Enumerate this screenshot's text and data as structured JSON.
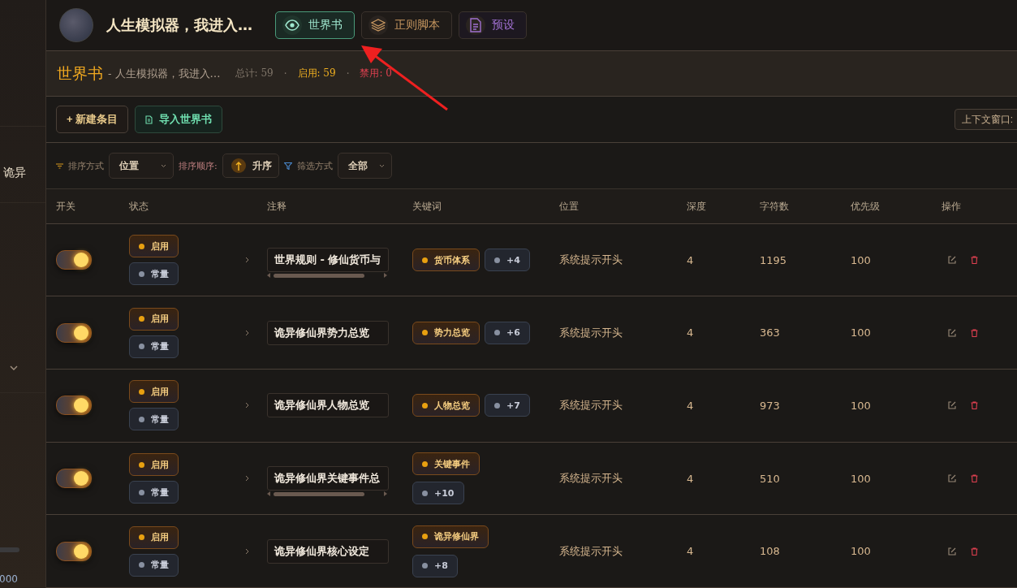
{
  "sidebar": {
    "snippet": "诡异",
    "counter": "000"
  },
  "header": {
    "title": "人生模拟器，我进入…",
    "tabs": [
      {
        "label": "世界书",
        "selected": true
      },
      {
        "label": "正则脚本",
        "selected": false
      },
      {
        "label": "预设",
        "selected": false
      }
    ]
  },
  "book_bar": {
    "title": "世界书",
    "subtitle": "- 人生模拟器，我进入…",
    "total": "总计: 59",
    "separator_1": "·",
    "enabled": "启用: 59",
    "separator_2": "·",
    "disabled": "禁用: 0"
  },
  "toolbar": {
    "new_entry": "+ 新建条目",
    "import": "导入世界书",
    "context_window": "上下文窗口:"
  },
  "filters": {
    "sort_by_label": "排序方式",
    "sort_by_value": "位置",
    "sort_order_label": "排序顺序:",
    "sort_order_value": "升序",
    "filter_label": "筛选方式",
    "filter_value": "全部"
  },
  "table": {
    "columns": [
      "开关",
      "状态",
      "注释",
      "关键词",
      "位置",
      "深度",
      "字符数",
      "优先级",
      "操作"
    ],
    "rows": [
      {
        "on": true,
        "status": "启用",
        "mode": "常量",
        "comment": "世界规则 - 修仙货币与",
        "overflow": true,
        "keyword": "货币体系",
        "more": "+4",
        "position": "系统提示开头",
        "depth": "4",
        "chars": "1195",
        "priority": "100"
      },
      {
        "on": true,
        "status": "启用",
        "mode": "常量",
        "comment": "诡异修仙界势力总览",
        "overflow": false,
        "keyword": "势力总览",
        "more": "+6",
        "position": "系统提示开头",
        "depth": "4",
        "chars": "363",
        "priority": "100"
      },
      {
        "on": true,
        "status": "启用",
        "mode": "常量",
        "comment": "诡异修仙界人物总览",
        "overflow": false,
        "keyword": "人物总览",
        "more": "+7",
        "position": "系统提示开头",
        "depth": "4",
        "chars": "973",
        "priority": "100"
      },
      {
        "on": true,
        "status": "启用",
        "mode": "常量",
        "comment": "诡异修仙界关键事件总",
        "overflow": true,
        "keyword": "关键事件",
        "more": "+10",
        "position": "系统提示开头",
        "depth": "4",
        "chars": "510",
        "priority": "100"
      },
      {
        "on": true,
        "status": "启用",
        "mode": "常量",
        "comment": "诡异修仙界核心设定",
        "overflow": false,
        "keyword": "诡异修仙界",
        "more": "+8",
        "position": "系统提示开头",
        "depth": "4",
        "chars": "108",
        "priority": "100"
      }
    ]
  }
}
